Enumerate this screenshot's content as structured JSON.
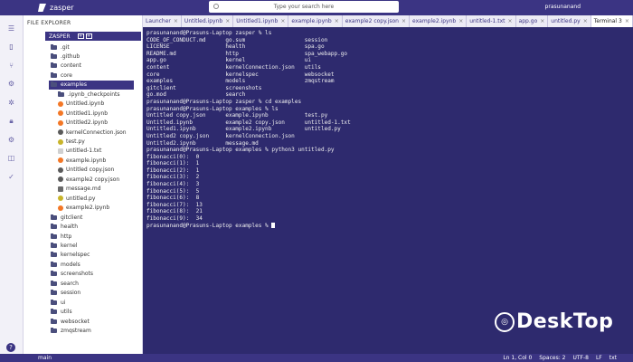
{
  "app": {
    "name": "zasper",
    "user": "prasunanand",
    "search_placeholder": "Type your search here"
  },
  "activity_icons": [
    "menu-icon",
    "files-icon",
    "git-branch-icon",
    "kernel-icon",
    "gear-icon",
    "lock-icon",
    "settings-icon",
    "database-icon",
    "check-icon",
    "help-icon"
  ],
  "side_panel": {
    "title": "FILE EXPLORER",
    "root": "ZASPER",
    "tree": [
      {
        "name": ".git",
        "type": "folder",
        "depth": 1
      },
      {
        "name": ".github",
        "type": "folder",
        "depth": 1
      },
      {
        "name": "content",
        "type": "folder",
        "depth": 1
      },
      {
        "name": "core",
        "type": "folder",
        "depth": 1
      },
      {
        "name": "examples",
        "type": "folder",
        "depth": 1,
        "selected": true
      },
      {
        "name": ".ipynb_checkpoints",
        "type": "folder",
        "depth": 2
      },
      {
        "name": "Untitled.ipynb",
        "type": "nb",
        "depth": 2
      },
      {
        "name": "Untitled1.ipynb",
        "type": "nb",
        "depth": 2
      },
      {
        "name": "Untitled2.ipynb",
        "type": "nb",
        "depth": 2
      },
      {
        "name": "kernelConnection.json",
        "type": "json",
        "depth": 2
      },
      {
        "name": "test.py",
        "type": "py",
        "depth": 2
      },
      {
        "name": "untitled-1.txt",
        "type": "txt",
        "depth": 2
      },
      {
        "name": "example.ipynb",
        "type": "nb",
        "depth": 2
      },
      {
        "name": "Untitled copy.json",
        "type": "json",
        "depth": 2
      },
      {
        "name": "example2 copy.json",
        "type": "json",
        "depth": 2
      },
      {
        "name": "message.md",
        "type": "md",
        "depth": 2
      },
      {
        "name": "untitled.py",
        "type": "py",
        "depth": 2
      },
      {
        "name": "example2.ipynb",
        "type": "nb",
        "depth": 2
      },
      {
        "name": "gitclient",
        "type": "folder",
        "depth": 1
      },
      {
        "name": "health",
        "type": "folder",
        "depth": 1
      },
      {
        "name": "http",
        "type": "folder",
        "depth": 1
      },
      {
        "name": "kernel",
        "type": "folder",
        "depth": 1
      },
      {
        "name": "kernelspec",
        "type": "folder",
        "depth": 1
      },
      {
        "name": "models",
        "type": "folder",
        "depth": 1
      },
      {
        "name": "screenshots",
        "type": "folder",
        "depth": 1
      },
      {
        "name": "search",
        "type": "folder",
        "depth": 1
      },
      {
        "name": "session",
        "type": "folder",
        "depth": 1
      },
      {
        "name": "ui",
        "type": "folder",
        "depth": 1
      },
      {
        "name": "utils",
        "type": "folder",
        "depth": 1
      },
      {
        "name": "websocket",
        "type": "folder",
        "depth": 1
      },
      {
        "name": "zmqstream",
        "type": "folder",
        "depth": 1
      }
    ]
  },
  "tabs": [
    {
      "label": "Launcher",
      "active": false
    },
    {
      "label": "Untitled.ipynb",
      "active": false
    },
    {
      "label": "Untitled1.ipynb",
      "active": false
    },
    {
      "label": "example.ipynb",
      "active": false
    },
    {
      "label": "example2 copy.json",
      "active": false
    },
    {
      "label": "example2.ipynb",
      "active": false
    },
    {
      "label": "untitled-1.txt",
      "active": false
    },
    {
      "label": "app.go",
      "active": false
    },
    {
      "label": "untitled.py",
      "active": false
    },
    {
      "label": "Terminal 3",
      "active": true
    }
  ],
  "terminal": {
    "lines": [
      "prasunanand@Prasuns-Laptop zasper % ls",
      "CODE_OF_CONDUCT.md      go.sum                  session",
      "LICENSE                 health                  spa.go",
      "README.md               http                    spa_webapp.go",
      "app.go                  kernel                  ui",
      "content                 kernelConnection.json   utils",
      "core                    kernelspec              websocket",
      "examples                models                  zmqstream",
      "gitclient               screenshots",
      "go.mod                  search",
      "prasunanand@Prasuns-Laptop zasper % cd examples",
      "prasunanand@Prasuns-Laptop examples % ls",
      "Untitled copy.json      example.ipynb           test.py",
      "Untitled.ipynb          example2 copy.json      untitled-1.txt",
      "Untitled1.ipynb         example2.ipynb          untitled.py",
      "Untitled2 copy.json     kernelConnection.json",
      "Untitled2.ipynb         message.md",
      "prasunanand@Prasuns-Laptop examples % python3 untitled.py",
      "fibonacci(0):  0",
      "fibonacci(1):  1",
      "fibonacci(2):  1",
      "fibonacci(3):  2",
      "fibonacci(4):  3",
      "fibonacci(5):  5",
      "fibonacci(6):  8",
      "fibonacci(7):  13",
      "fibonacci(8):  21",
      "fibonacci(9):  34"
    ],
    "prompt": "prasunanand@Prasuns-Laptop examples % "
  },
  "status_bar": {
    "branch": "main",
    "position": "Ln 1, Col 0",
    "spaces": "Spaces: 2",
    "encoding": "UTF-8",
    "eol": "LF",
    "language": "txt"
  },
  "watermark": {
    "text": "DeskTop"
  }
}
